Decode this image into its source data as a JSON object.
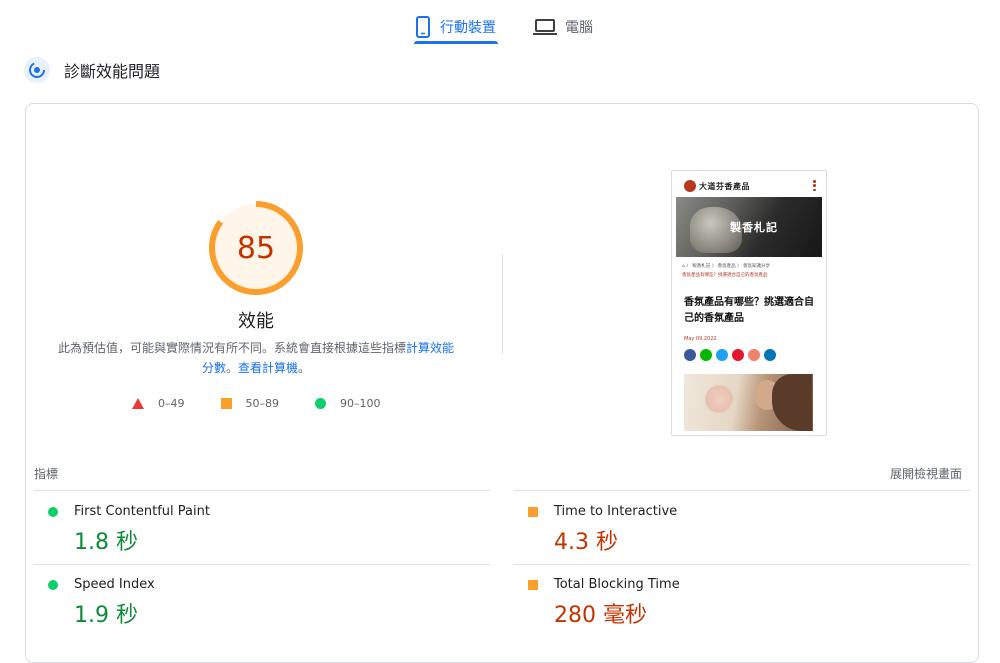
{
  "tabs": {
    "mobile_label": "行動裝置",
    "desktop_label": "電腦",
    "active": "mobile"
  },
  "diagnose": {
    "title": "診斷效能問題",
    "icon": "performance-gauge-icon"
  },
  "score": {
    "value": "85",
    "fraction": 0.85,
    "title": "效能",
    "description_prefix": "此為預估值，可能與實際情況有所不同。系統會直接根據這些指標",
    "description_link": "計算效能分數",
    "description_sep": "。",
    "calculator_link": "查看計算機",
    "description_end": "。"
  },
  "legend": [
    {
      "shape": "triangle",
      "color": "#e53935",
      "label": "0–49"
    },
    {
      "shape": "square",
      "color": "#fa9f2b",
      "label": "50–89"
    },
    {
      "shape": "circle",
      "color": "#0cce6b",
      "label": "90–100"
    }
  ],
  "screenshot": {
    "brand": "大道芬香產品",
    "banner_text": "製香札記",
    "breadcrumb": "⌂ 〉 製香札記 〉 香氛產品 〉 香氛知識分享",
    "breadcrumb_current": "香氛產品有哪些？挑選適合自己的香氛產品",
    "article_title": "香氛產品有哪些？挑選適合自己的香氛產品",
    "date": "May 09,2022"
  },
  "metrics": {
    "header_left": "指標",
    "header_right": "展開檢視畫面",
    "items": [
      {
        "label": "First Contentful Paint",
        "value": "1.8 秒",
        "status": "good"
      },
      {
        "label": "Time to Interactive",
        "value": "4.3 秒",
        "status": "average"
      },
      {
        "label": "Speed Index",
        "value": "1.9 秒",
        "status": "good"
      },
      {
        "label": "Total Blocking Time",
        "value": "280 毫秒",
        "status": "average"
      }
    ]
  },
  "colors": {
    "accent": "#1a73e8",
    "score_average": "#fa9f2b",
    "score_text": "#c33300",
    "good": "#0cce6b"
  }
}
